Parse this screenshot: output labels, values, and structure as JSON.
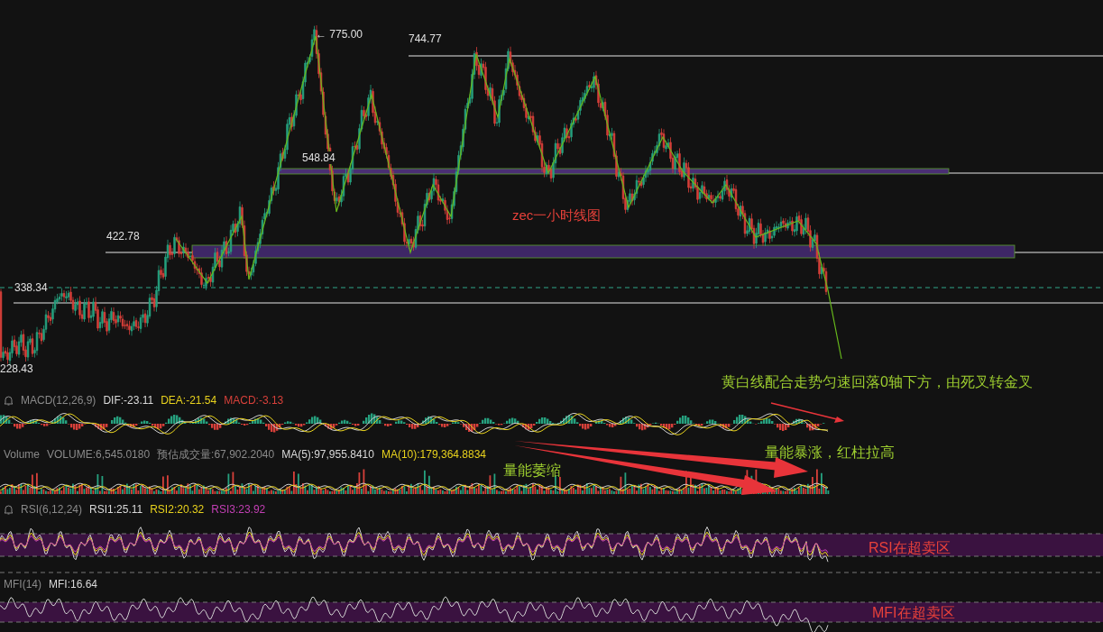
{
  "price_chart": {
    "price_labels": [
      "← 775.00",
      "744.77",
      "548.84",
      "422.78",
      "338.34",
      "228.43"
    ],
    "title_note": "zec一小时线图"
  },
  "indicators": [
    {
      "kind": "macd",
      "name": "MACD(12,26,9)",
      "alert": true,
      "values": [
        {
          "text": "DIF:-23.11",
          "color": "#d9d9d9"
        },
        {
          "text": "DEA:-21.54",
          "color": "#e8d21d"
        },
        {
          "text": "MACD:-3.13",
          "color": "#d8403a"
        }
      ]
    },
    {
      "kind": "volume",
      "name": "Volume",
      "alert": false,
      "values": [
        {
          "text": "VOLUME:6,545.0180",
          "color": "#8a8a8a"
        },
        {
          "text": "预估成交量:67,902.2040",
          "color": "#8a8a8a"
        },
        {
          "text": "MA(5):97,955.8410",
          "color": "#d9d9d9"
        },
        {
          "text": "MA(10):179,364.8834",
          "color": "#e8d21d"
        }
      ]
    },
    {
      "kind": "rsi",
      "name": "RSI(6,12,24)",
      "alert": true,
      "values": [
        {
          "text": "RSI1:25.11",
          "color": "#d9d9d9"
        },
        {
          "text": "RSI2:20.32",
          "color": "#e8d21d"
        },
        {
          "text": "RSI3:23.92",
          "color": "#c23fb4"
        }
      ]
    },
    {
      "kind": "mfi",
      "name": "MFI(14)",
      "alert": false,
      "values": [
        {
          "text": "MFI:16.64",
          "color": "#d9d9d9"
        }
      ]
    }
  ],
  "annotations": [
    {
      "text": "黄白线配合走势匀速回落0轴下方，由死叉转金叉",
      "color": "#9ccc2f"
    },
    {
      "text": "量能暴涨，红柱拉高",
      "color": "#9ccc2f"
    },
    {
      "text": "量能萎缩",
      "color": "#9ccc2f"
    },
    {
      "text": "RSI在超卖区",
      "color": "#e8413a"
    },
    {
      "text": "MFI在超卖区",
      "color": "#e8413a"
    }
  ]
}
